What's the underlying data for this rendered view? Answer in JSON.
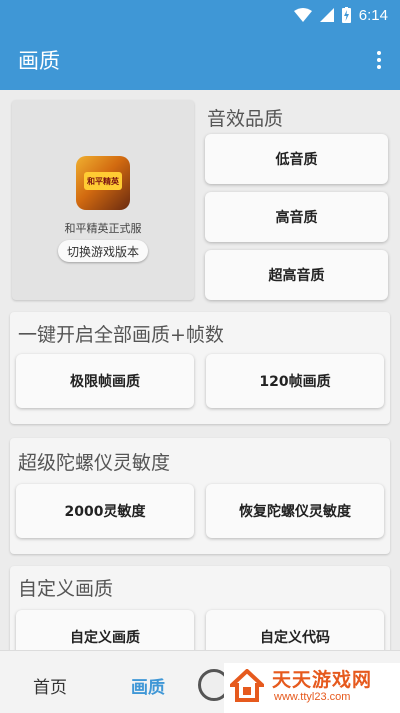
{
  "statusbar": {
    "time": "6:14"
  },
  "appbar": {
    "title": "画质"
  },
  "game": {
    "name": "和平精英正式服",
    "logo_text": "和平精英",
    "switch_label": "切换游戏版本"
  },
  "sound": {
    "title": "音效品质",
    "buttons": [
      "低音质",
      "高音质",
      "超高音质"
    ]
  },
  "onekey": {
    "title": "一键开启全部画质+帧数",
    "buttons": [
      "极限帧画质",
      "120帧画质"
    ]
  },
  "gyro": {
    "title": "超级陀螺仪灵敏度",
    "buttons": [
      "2000灵敏度",
      "恢复陀螺仪灵敏度"
    ]
  },
  "custom": {
    "title": "自定义画质",
    "buttons": [
      "自定义画质",
      "自定义代码"
    ]
  },
  "bottomnav": {
    "home": "首页",
    "quality": "画质"
  },
  "watermark": {
    "title": "天天游戏网",
    "url": "www.ttyl23.com"
  },
  "colors": {
    "primary": "#3f97d6",
    "watermark": "#e65a1e"
  }
}
